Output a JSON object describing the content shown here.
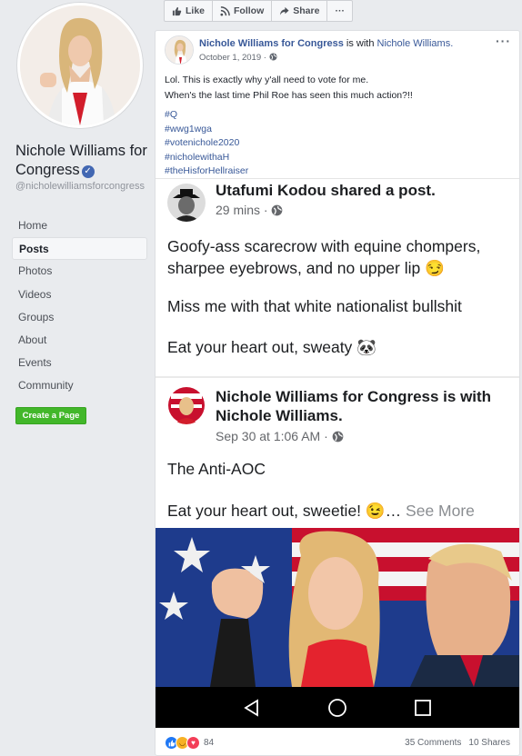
{
  "page": {
    "name": "Nichole Williams for Congress",
    "handle": "@nicholewilliamsforcongress",
    "nav": [
      "Home",
      "Posts",
      "Photos",
      "Videos",
      "Groups",
      "About",
      "Events",
      "Community"
    ],
    "active_nav": "Posts",
    "create_page_label": "Create a Page"
  },
  "actionbar": {
    "like": "Like",
    "follow": "Follow",
    "share": "Share",
    "more": "···"
  },
  "post": {
    "author": "Nichole Williams for Congress",
    "with_text": " is with ",
    "tagged": "Nichole Williams.",
    "date": "October 1, 2019 ·",
    "text_line1": "Lol. This is exactly why y'all need to vote for me.",
    "text_line2": "When's the last time Phil Roe has seen this much action?!!",
    "hashtags": [
      "#Q",
      "#wwg1wga",
      "#votenichole2020",
      "#nicholewithaH",
      "#theHisforHellraiser"
    ],
    "more_label": "···",
    "reaction_count": "84",
    "comments": "35 Comments",
    "shares": "10 Shares"
  },
  "screenshot": {
    "sharer_name": "Utafumi Kodou shared a post.",
    "sharer_time": "29 mins ·",
    "text1_line1": "Goofy-ass scarecrow with equine chompers,",
    "text1_line2": "sharpee eyebrows, and no upper lip 😏",
    "text2": "Miss me with that white nationalist bullshit",
    "text3": "Eat your heart out, sweaty 🐼",
    "orig_name_line1": "Nichole Williams for Congress is with",
    "orig_name_line2": "Nichole Williams.",
    "orig_time": "Sep 30 at 1:06 AM ·",
    "orig_text1": "The Anti-AOC",
    "orig_text2": "Eat your heart out, sweetie! 😉…",
    "see_more": " See More"
  },
  "colors": {
    "link": "#385898",
    "fb_blue": "#4267b2",
    "green": "#42b72a",
    "bg": "#e9ebee"
  }
}
